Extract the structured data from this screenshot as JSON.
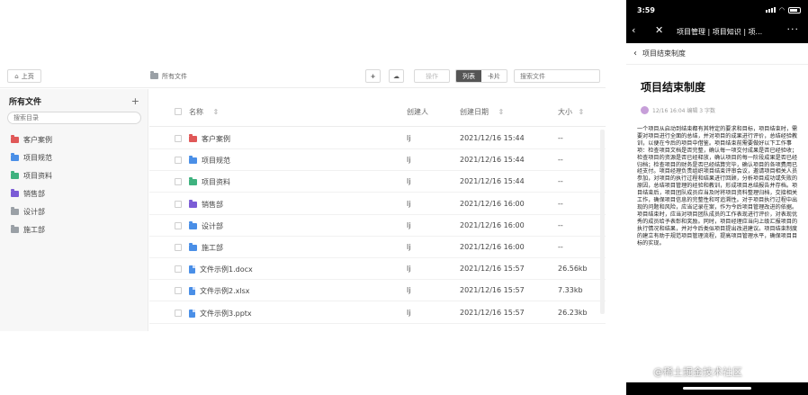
{
  "desktop": {
    "toolbar": {
      "home_label": "上页",
      "path_label": "所有文件",
      "add_label": "+",
      "upload_label": "☁",
      "operate_label": "操作",
      "view_list": "列表",
      "view_grid": "卡片",
      "search_placeholder": "搜索文件"
    },
    "sidebar": {
      "title": "所有文件",
      "add": "+",
      "filter_placeholder": "搜索目录",
      "items": [
        {
          "label": "客户案例",
          "color": "#e05858"
        },
        {
          "label": "项目规范",
          "color": "#4a8fe7"
        },
        {
          "label": "项目资料",
          "color": "#3fb27f"
        },
        {
          "label": "销售部",
          "color": "#7b5cd6"
        },
        {
          "label": "设计部",
          "color": "#9aa0a6"
        },
        {
          "label": "施工部",
          "color": "#9aa0a6"
        }
      ]
    },
    "table": {
      "headers": {
        "name": "名称",
        "creator": "创建人",
        "created": "创建日期",
        "size": "大小"
      },
      "sort_icon": "⇕",
      "rows": [
        {
          "name": "客户案例",
          "type": "folder",
          "color": "#e05858",
          "creator": "lj",
          "date": "2021/12/16 15:44",
          "size": "--"
        },
        {
          "name": "项目规范",
          "type": "folder",
          "color": "#4a8fe7",
          "creator": "lj",
          "date": "2021/12/16 15:44",
          "size": "--"
        },
        {
          "name": "项目资料",
          "type": "folder",
          "color": "#3fb27f",
          "creator": "lj",
          "date": "2021/12/16 15:44",
          "size": "--"
        },
        {
          "name": "销售部",
          "type": "folder",
          "color": "#7b5cd6",
          "creator": "lj",
          "date": "2021/12/16 16:00",
          "size": "--"
        },
        {
          "name": "设计部",
          "type": "folder",
          "color": "#4a8fe7",
          "creator": "lj",
          "date": "2021/12/16 16:00",
          "size": "--"
        },
        {
          "name": "施工部",
          "type": "folder",
          "color": "#4a8fe7",
          "creator": "lj",
          "date": "2021/12/16 16:00",
          "size": "--"
        },
        {
          "name": "文件示例1.docx",
          "type": "doc",
          "color": "#4a8fe7",
          "creator": "lj",
          "date": "2021/12/16 15:57",
          "size": "26.56kb"
        },
        {
          "name": "文件示例2.xlsx",
          "type": "doc",
          "color": "#4a8fe7",
          "creator": "lj",
          "date": "2021/12/16 15:57",
          "size": "7.33kb"
        },
        {
          "name": "文件示例3.pptx",
          "type": "doc",
          "color": "#4a8fe7",
          "creator": "lj",
          "date": "2021/12/16 15:57",
          "size": "26.23kb"
        }
      ]
    }
  },
  "phone": {
    "status_time": "3:59",
    "nav_back": "‹",
    "nav_close": "✕",
    "nav_title": "项目管理 | 项目知识 | 项...",
    "nav_more": "···",
    "crumb": "项目结束制度",
    "doc_title": "项目结束制度",
    "meta": "12/16 16:04 编辑  3 字数",
    "body": "一个项目从启动到结束都有其特定的要求和目标，项目结束时，需要对项目进行全面的总结，并对项目的成果进行评价，总结经验教训，以便在今后的项目中借鉴。项目结束前需要做好以下工作事项：检查项目文档是否完整，确认每一项交付成果是否已经验收；检查项目的资源是否已经释放，确认项目的每一阶段成果是否已经归档；检查项目的财务是否已经结算完毕，确认项目的各项费用已经支付。项目经理负责组织项目结束评审会议，邀请项目相关人员参加，对项目的执行过程和结果进行回顾，分析项目成功或失败的原因，总结项目管理的经验和教训，形成项目总结报告并存档。项目结束后，项目团队成员应当及时将项目资料整理归档，交接相关工作，确保项目信息的完整性和可追溯性。对于项目执行过程中出现的问题和风险，应当记录在案，作为今后项目管理改进的依据。项目结束时，应当对项目团队成员的工作表现进行评价，对表现优秀的成员给予表彰和奖励。同时，项目经理应当向上级汇报项目的执行情况和结果，并对今后类似项目提出改进建议。项目结束制度的建立有助于规范项目管理流程，提高项目管理水平，确保项目目标的实现。",
    "watermark": "@稀土掘金技术社区"
  }
}
